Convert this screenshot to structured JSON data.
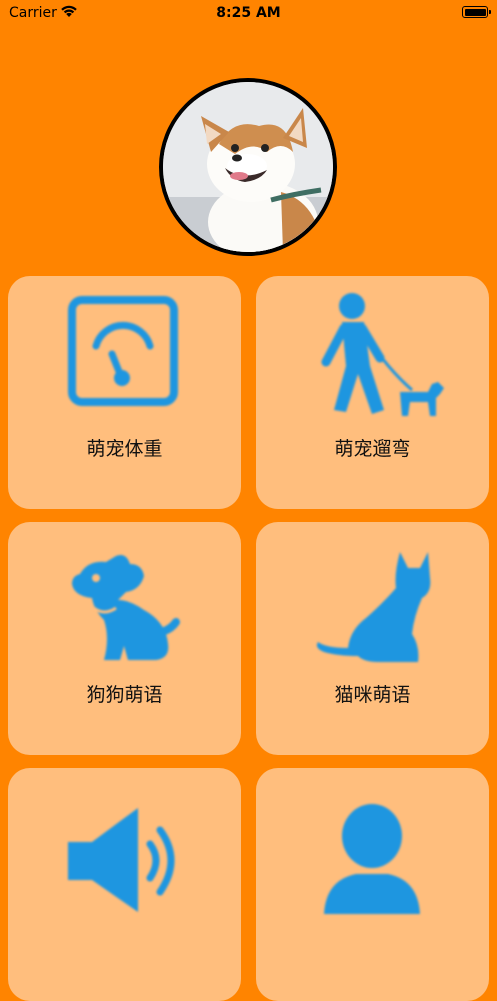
{
  "status_bar": {
    "carrier": "Carrier",
    "time": "8:25 AM"
  },
  "avatar": {
    "icon": "corgi-dog-photo"
  },
  "menu": {
    "items": [
      {
        "label": "萌宠体重",
        "icon": "scale-icon"
      },
      {
        "label": "萌宠遛弯",
        "icon": "person-walking-dog-icon"
      },
      {
        "label": "狗狗萌语",
        "icon": "dog-icon"
      },
      {
        "label": "猫咪萌语",
        "icon": "cat-icon"
      },
      {
        "label": "",
        "icon": "speaker-icon"
      },
      {
        "label": "",
        "icon": "person-icon"
      }
    ]
  },
  "colors": {
    "background": "#ff8400",
    "tile": "#ffbe7d",
    "icon": "#1e96e0"
  }
}
